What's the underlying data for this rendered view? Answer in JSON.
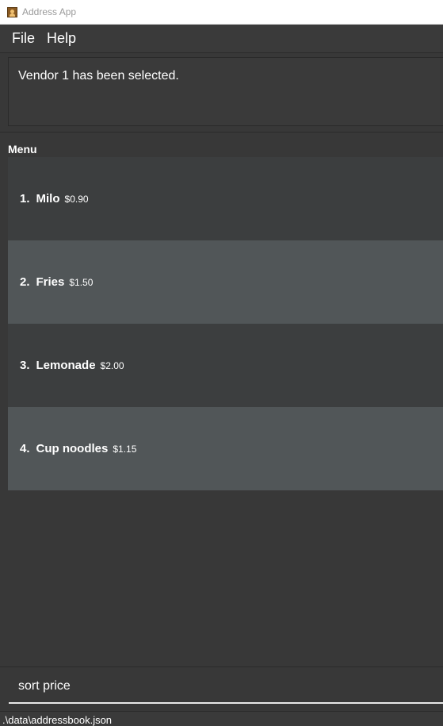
{
  "window": {
    "title": "Address App",
    "icon": "app-icon"
  },
  "menubar": {
    "file_label": "File",
    "help_label": "Help"
  },
  "result": {
    "message": "Vendor 1 has been selected."
  },
  "menu_panel": {
    "label": "Menu",
    "items": [
      {
        "index": "1.",
        "name": "Milo",
        "price": "$0.90"
      },
      {
        "index": "2.",
        "name": "Fries",
        "price": "$1.50"
      },
      {
        "index": "3.",
        "name": "Lemonade",
        "price": "$2.00"
      },
      {
        "index": "4.",
        "name": "Cup noodles",
        "price": "$1.15"
      }
    ]
  },
  "command": {
    "value": "sort price"
  },
  "status": {
    "path": ".\\data\\addressbook.json"
  },
  "colors": {
    "background": "#383838",
    "row_odd": "#3c3e3f",
    "row_even": "#515658",
    "text": "#ffffff"
  }
}
